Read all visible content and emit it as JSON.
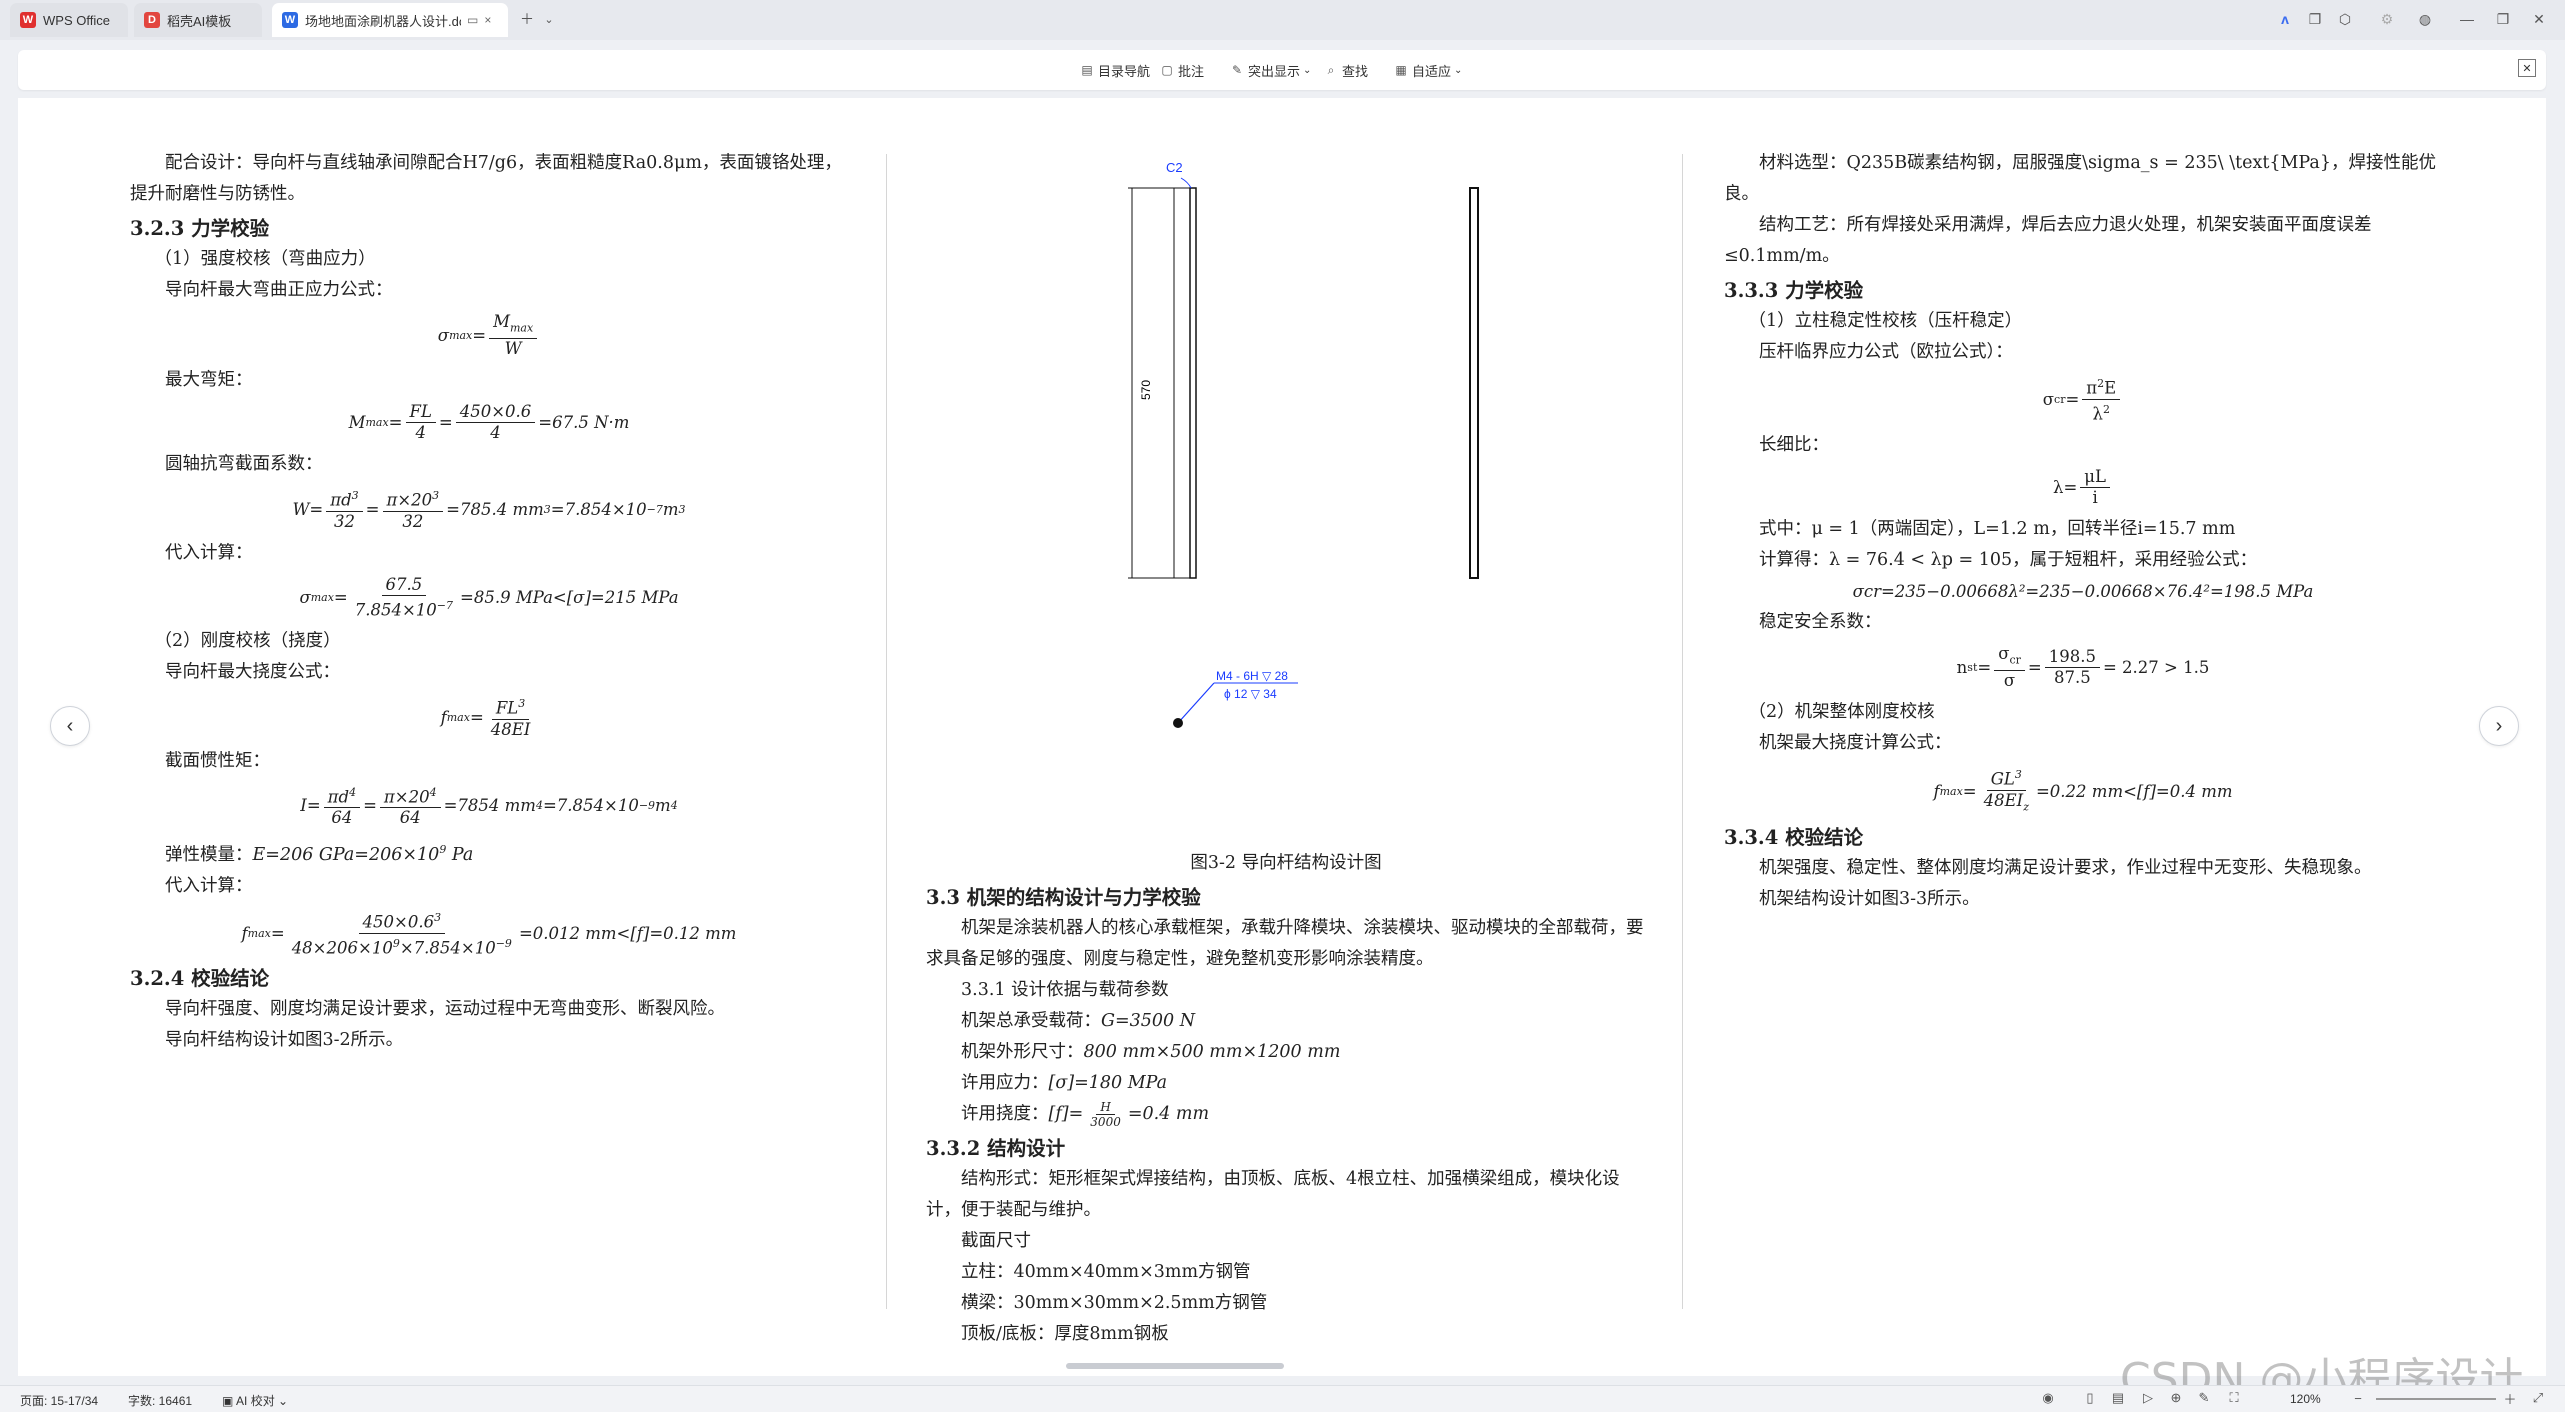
{
  "tabs": [
    {
      "label": "WPS Office",
      "color": "#e0302f"
    },
    {
      "label": "稻壳AI模板",
      "color": "#e2463f"
    },
    {
      "label": "场地地面涂刷机器人设计.do",
      "color": "#2d6ae3"
    }
  ],
  "toolbar": {
    "nav": "目录导航",
    "comment": "批注",
    "highlight": "突出显示",
    "find": "查找",
    "fit": "自适应"
  },
  "left": {
    "p1": "配合设计：导向杆与直线轴承间隙配合H7/g6，表面粗糙度Ra0.8μm，表面镀铬处理，提升耐磨性与防锈性。",
    "h323": "3.2.3 力学校验",
    "s1": "（1）强度校核（弯曲应力）",
    "l1": "导向杆最大弯曲正应力公式：",
    "l2": "最大弯矩：",
    "l3": "圆轴抗弯截面系数：",
    "l4": "代入计算：",
    "s2": "（2）刚度校核（挠度）",
    "l5": "导向杆最大挠度公式：",
    "l6": "截面惯性矩：",
    "l7": "弹性模量：",
    "l7eq": "E=206 GPa=206×10",
    "l7sup": "9",
    "l7u": " Pa",
    "l8": "代入计算：",
    "h324": "3.2.4 校验结论",
    "c1": "导向杆强度、刚度均满足设计要求，运动过程中无弯曲变形、断裂风险。",
    "c2": "导向杆结构设计如图3-2所示。"
  },
  "eqs": {
    "sigma": "σ",
    "max": "max",
    "M": "M",
    "W": "W",
    "FL": "FL",
    "four": "4",
    "b450": "450×0.6",
    "r675": "=67.5 N·m",
    "pid3": "πd",
    "three": "3",
    "t32": "32",
    "pi20": "π×20",
    "r7854": "=785.4 mm",
    "r7854b": "=7.854×10",
    "m7": "−7",
    "m3": " m",
    "n675": "67.5",
    "d7854": "7.854×10",
    "r859": "=85.9 MPa<[σ]=215 MPa",
    "f": "f",
    "FL3": "FL",
    "EI48": "48EI",
    "I": "I",
    "pid4": "πd",
    "sixfour": "64",
    "pi204": "π×20",
    "r7854i": "=7854 mm",
    "r7854ib": "=7.854×10",
    "m9": "−9",
    "m4": " m",
    "n4506": "450×0.6",
    "d48": "48×206×10",
    "d48b": "×7.854×10",
    "r012": "=0.012 mm<[f]=0.12 mm"
  },
  "figure": {
    "label_c2": "C2",
    "dim": "570",
    "anno1": "M4 - 6H ▽ 28",
    "anno2": "ϕ 12 ▽ 34",
    "caption": "图3-2 导向杆结构设计图"
  },
  "mid": {
    "h33": "3.3 机架的结构设计与力学校验",
    "p1": "机架是涂装机器人的核心承载框架，承载升降模块、涂装模块、驱动模块的全部载荷，要求具备足够的强度、刚度与稳定性，避免整机变形影响涂装精度。",
    "s331": "3.3.1 设计依据与载荷参数",
    "l1a": "机架总承受载荷：",
    "l1b": "G=3500 N",
    "l2a": "机架外形尺寸：",
    "l2b": "800 mm×500 mm×1200 mm",
    "l3a": "许用应力：",
    "l3b": "[σ]=180 MPa",
    "l4a": "许用挠度：",
    "l4b": "[f]=",
    "l4n": "H",
    "l4d": "3000",
    "l4c": "=0.4 mm",
    "h332": "3.3.2 结构设计",
    "p2": "结构形式：矩形框架式焊接结构，由顶板、底板、4根立柱、加强横梁组成，模块化设计，便于装配与维护。",
    "i1": "截面尺寸",
    "i2": "立柱：40mm×40mm×3mm方钢管",
    "i3": "横梁：30mm×30mm×2.5mm方钢管",
    "i4": "顶板/底板：厚度8mm钢板"
  },
  "right": {
    "p1": "材料选型：Q235B碳素结构钢，屈服强度\\sigma_s = 235\\ \\text{MPa}，焊接性能优良。",
    "p2": "结构工艺：所有焊接处采用满焊，焊后去应力退火处理，机架安装面平面度误差≤0.1mm/m。",
    "h333": "3.3.3 力学校验",
    "s1": "（1）立柱稳定性校核（压杆稳定）",
    "l1": "压杆临界应力公式（欧拉公式）：",
    "e1a": "σ",
    "e1sub": "cr",
    "e1n": "π",
    "e1nsup": "2",
    "e1nE": "E",
    "e1d": "λ",
    "e1dsup": "2",
    "l2": "长细比：",
    "e2a": "λ",
    "e2n": "μL",
    "e2d": "i",
    "l3": "式中：μ = 1（两端固定），L=1.2 m，回转半径i=15.7 mm",
    "l4": "计算得：λ = 76.4 < λp = 105，属于短粗杆，采用经验公式：",
    "e3": "σcr=235−0.00668λ²=235−0.00668×76.4²=198.5 MPa",
    "l5": "稳定安全系数：",
    "e4a": "n",
    "e4sub": "st",
    "e4n1": "σ",
    "e4n1sub": "cr",
    "e4d1": "σ",
    "e4n2": "198.5",
    "e4d2": "87.5",
    "e4r": "= 2.27 > 1.5",
    "s2": "（2）机架整体刚度校核",
    "l6": "机架最大挠度计算公式：",
    "e5n": "GL",
    "e5nsup": "3",
    "e5d": "48EI",
    "e5dsub": "z",
    "e5r": "=0.22 mm<[f]=0.4 mm",
    "h334": "3.3.4 校验结论",
    "c1": "机架强度、稳定性、整体刚度均满足设计要求，作业过程中无变形、失稳现象。",
    "c2": "机架结构设计如图3-3所示。"
  },
  "status": {
    "pages": "页面: 15-17/34",
    "words": "字数: 16461",
    "ai": "AI 校对",
    "zoom": "120%"
  },
  "watermark": "CSDN @小程序设计"
}
